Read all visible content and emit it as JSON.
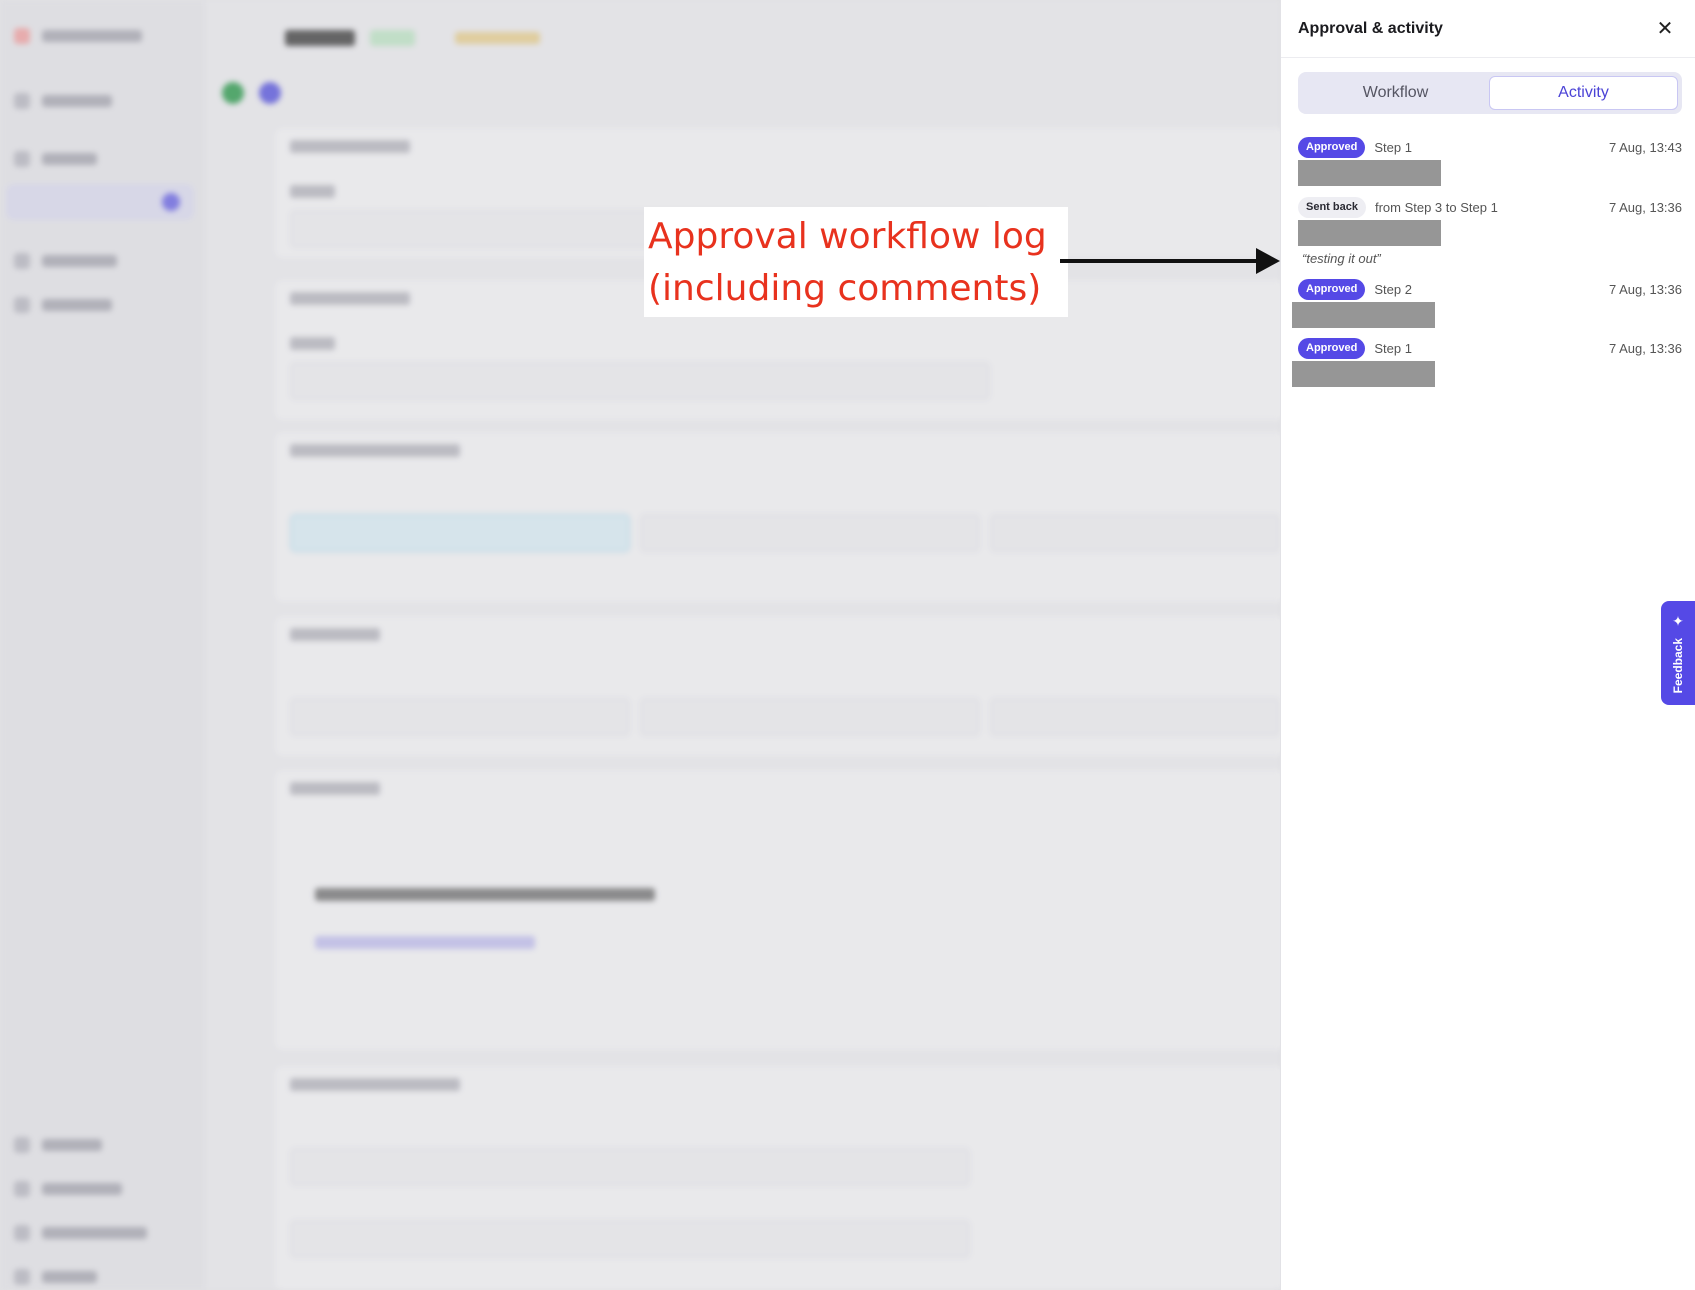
{
  "annotation": {
    "text": "Approval workflow log\n(including comments)"
  },
  "panel": {
    "title": "Approval & activity",
    "close_icon": "close-icon",
    "tabs": [
      {
        "label": "Workflow",
        "active": false
      },
      {
        "label": "Activity",
        "active": true
      }
    ],
    "entries": [
      {
        "badge": "Approved",
        "description": "Step 1",
        "time": "7 Aug, 13:43",
        "comment": ""
      },
      {
        "badge": "Sent back",
        "description": "from Step 3 to Step 1",
        "time": "7 Aug, 13:36",
        "comment": "“testing it out”"
      },
      {
        "badge": "Approved",
        "description": "Step 2",
        "time": "7 Aug, 13:36",
        "comment": ""
      },
      {
        "badge": "Approved",
        "description": "Step 1",
        "time": "7 Aug, 13:36",
        "comment": ""
      }
    ]
  },
  "feedback": {
    "label": "Feedback",
    "icon": "sparkle-icon"
  },
  "colors": {
    "accent": "#5549e6",
    "annotation": "#e8321e",
    "redaction": "#969696"
  }
}
